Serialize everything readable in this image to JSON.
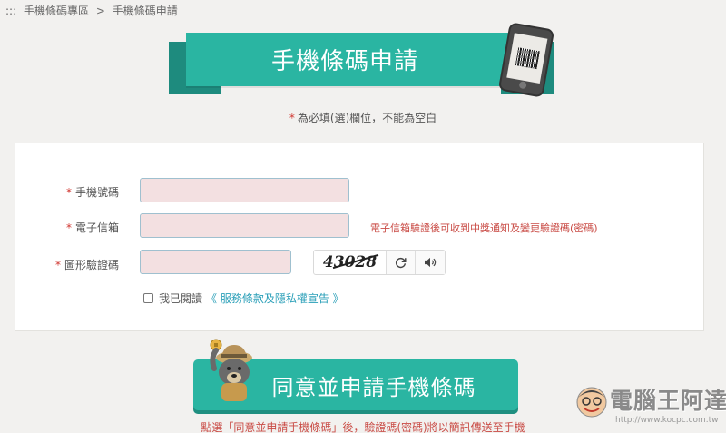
{
  "breadcrumb": {
    "prefix": ":::",
    "parent": "手機條碼專區",
    "separator": ">",
    "current": "手機條碼申請"
  },
  "banner": {
    "title": "手機條碼申請",
    "phone_icon": "phone-barcode-icon"
  },
  "required_note": {
    "star": "*",
    "text": "為必填(選)欄位，不能為空白"
  },
  "form": {
    "phone": {
      "star": "*",
      "label": "手機號碼",
      "value": ""
    },
    "email": {
      "star": "*",
      "label": "電子信箱",
      "value": "",
      "hint": "電子信箱驗證後可收到中獎通知及變更驗證碼(密碼)"
    },
    "captcha": {
      "star": "*",
      "label": "圖形驗證碼",
      "value": "",
      "image_text": "43028"
    },
    "agree": {
      "checked": false,
      "text": "我已閱讀",
      "link": "《 服務條款及隱私權宣告 》"
    }
  },
  "submit": {
    "label": "同意並申請手機條碼"
  },
  "bottom_note": "點選「同意並申請手機條碼」後，驗證碼(密碼)將以簡訊傳送至手機",
  "watermark": {
    "text": "電腦王阿達",
    "url": "http://www.kocpc.com.tw"
  },
  "colors": {
    "teal": "#2ab5a2",
    "teal_dark": "#1e8b7e",
    "required_red": "#d0352f",
    "link_blue": "#2a9fb8",
    "field_bg": "#f3e0e1"
  }
}
